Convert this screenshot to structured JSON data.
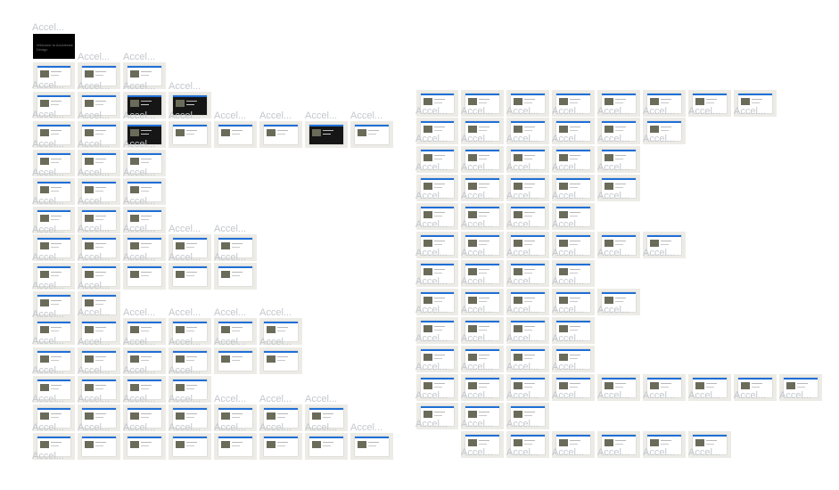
{
  "frame_label": "Accel...",
  "hero_card": {
    "text": "Welcome to Accelerate Design"
  },
  "left_rows": [
    {
      "frames": 2
    },
    {
      "frames": 3
    },
    {
      "frames": 7
    },
    {
      "frames": 2
    },
    {
      "frames": 2
    },
    {
      "frames": 2
    },
    {
      "frames": 4
    },
    {
      "frames": 4
    },
    {
      "frames": 1
    },
    {
      "frames": 5
    },
    {
      "frames": 5
    },
    {
      "frames": 3
    },
    {
      "frames": 6
    },
    {
      "frames": 7
    }
  ],
  "right_rows": [
    {
      "frames": 7
    },
    {
      "frames": 5
    },
    {
      "frames": 4
    },
    {
      "frames": 4
    },
    {
      "frames": 3
    },
    {
      "frames": 5
    },
    {
      "frames": 3
    },
    {
      "frames": 4
    },
    {
      "frames": 3
    },
    {
      "frames": 3
    },
    {
      "frames": 8
    },
    {
      "frames": 2
    },
    {
      "frames": 6
    }
  ],
  "colors": {
    "frame_bg": "#ecebe6",
    "label": "#c3c7cc",
    "accent": "#1f6fd6"
  }
}
